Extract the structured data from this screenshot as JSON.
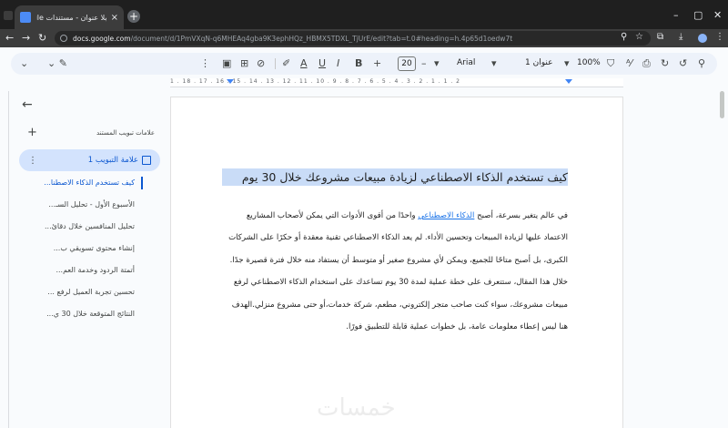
{
  "browser": {
    "tab_title": "بلا عنوان - مستندات Google",
    "tab_close": "×",
    "new_tab": "+",
    "url_domain": "docs.google.com",
    "url_path": "/document/d/1PmVXqN-q6MHEAq4gba9K3ephHQz_HBMX5TDXL_TjUrE/edit?tab=t.0#heading=h.4p65d1oedw7t",
    "window_controls": [
      "–",
      "▢",
      "✕"
    ]
  },
  "toolbar": {
    "font_size": "20",
    "font_name": "Arial",
    "style_name": "عنوان 1",
    "zoom": "100%",
    "minus": "–",
    "plus": "+"
  },
  "ruler": {
    "marks": "1 . 18 . 17 . 16 . 15 . 14 . 13 . 12 . 11 . 10 . 9 . 8 . 7 . 6 . 5 . 4 . 3 . 2 . 1 . 1 . 2"
  },
  "outline": {
    "header_label": "علامات تبويب المستند",
    "tab_label": "علامة التبويب 1",
    "items": [
      "كيف تستخدم الذكاء الاصطنا...",
      "الأسبوع الأول - تحليل السـ...",
      "تحليل المنافسين خلال دقائ...",
      "إنشاء محتوى تسويقي ب...",
      "أتمتة الردود وخدمة العم...",
      "تحسين تجربة العميل لرفع ...",
      "النتائج المتوقعة خلال 30 ي..."
    ]
  },
  "document": {
    "title": "كيف تستخدم الذكاء الاصطناعي لزيادة مبيعات مشروعك خلال 30 يوم",
    "p1_before": "في عالم يتغير بسرعة، أصبح ",
    "p1_link": "الذكاء الاصطناعي",
    "p1_after": " واحدًا من أقوى الأدوات التي يمكن لأصحاب المشاريع الاعتماد عليها لزيادة المبيعات وتحسين الأداء. لم يعد الذكاء الاصطناعي تقنية معقدة أو حكرًا على الشركات الكبرى، بل أصبح متاحًا للجميع، ويمكن لأي مشروع صغير أو متوسط أن يستفاد منه خلال فترة قصيرة جدًا.",
    "p2": "خلال هذا المقال، ستتعرف على خطة عملية لمدة 30 يوم تساعدك على استخدام الذكاء الاصطناعي لرفع مبيعات مشروعك، سواء كنت صاحب متجر إلكتروني، مطعم، شركة خدمات،أو حتى مشروع منزلي.الهدف هنا ليس إعطاء معلومات عامة، بل خطوات عملية قابلة للتطبيق فورًا.",
    "watermark": "خمسات"
  }
}
